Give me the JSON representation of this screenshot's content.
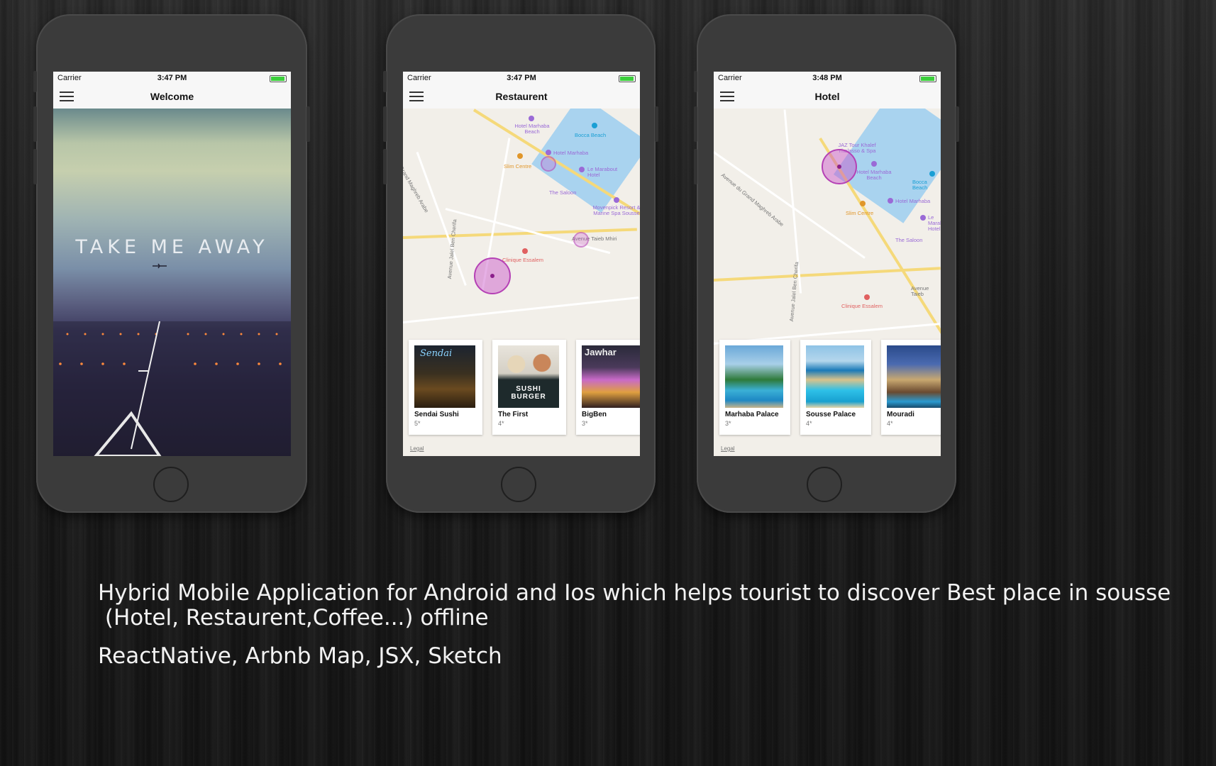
{
  "phones": [
    {
      "status": {
        "carrier": "Carrier",
        "time": "3:47 PM"
      },
      "title": "Welcome",
      "hero_text": "TAKE ME AWAY"
    },
    {
      "status": {
        "carrier": "Carrier",
        "time": "3:47 PM"
      },
      "title": "Restaurent",
      "map_labels": [
        "Hotel Marhaba Beach",
        "Bocca Beach",
        "Hotel Marhaba",
        "Slim Centre",
        "Le Marabout Hotel",
        "The Saloon",
        "Movenpick Resort & Marine Spa Sousse",
        "Avenue Taieb Mhiri",
        "Clinique Essalem",
        "Grand Maghreb Arabe",
        "Avenue Jalel Ben Cherifa"
      ],
      "cards": [
        {
          "name": "Sendai Sushi",
          "rating": "5*"
        },
        {
          "name": "The First",
          "rating": "4*"
        },
        {
          "name": "BigBen",
          "rating": "3*"
        }
      ],
      "legal": "Legal"
    },
    {
      "status": {
        "carrier": "Carrier",
        "time": "3:48 PM"
      },
      "title": "Hotel",
      "map_labels": [
        "JAZ Tour Khalef Thalasso & Spa",
        "Hotel Marhaba Beach",
        "Bocca Beach",
        "Hotel Marhaba",
        "Slim Centre",
        "Le Marabout Hotel",
        "The Saloon",
        "Avenue Taieb",
        "Clinique Essalem",
        "Avenue du Grand Maghreb Arabe",
        "Avenue Jalel Ben Cherifa"
      ],
      "cards": [
        {
          "name": "Marhaba Palace",
          "rating": "3*"
        },
        {
          "name": "Sousse Palace",
          "rating": "4*"
        },
        {
          "name": "Mouradi",
          "rating": "4*"
        }
      ],
      "legal": "Legal"
    }
  ],
  "caption": {
    "line1": "Hybrid Mobile Application for Android and Ios which helps tourist to discover Best place in sousse",
    "line2": " (Hotel, Restaurent,Coffee...) offline",
    "line3": "ReactNative, Arbnb Map, JSX, Sketch"
  },
  "colors": {
    "accent_pin": "#b541b5",
    "battery": "#3ccf3c",
    "phone_body": "#3b3b3b"
  }
}
